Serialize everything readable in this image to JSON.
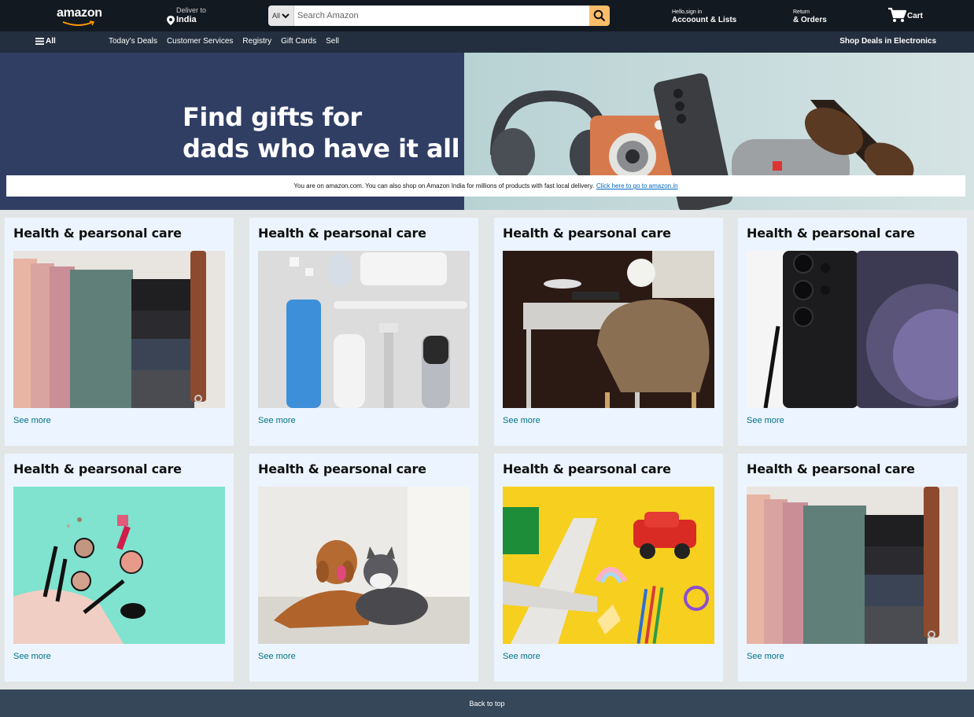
{
  "header": {
    "logo": "amazon",
    "deliver_label": "Deliver to",
    "deliver_location": "India",
    "search_category": "All",
    "search_placeholder": "Search Amazon",
    "account_greeting": "Hello,sign in",
    "account_label": "Accoount & Lists",
    "returns_label": "Return",
    "orders_label": "& Orders",
    "cart_label": "Cart"
  },
  "nav": {
    "all_label": "All",
    "links": [
      "Today's Deals",
      "Customer Services",
      "Registry",
      "Gift Cards",
      "Sell"
    ],
    "right_label": "Shop Deals in Electronics"
  },
  "hero": {
    "headline_line1": "Find gifts for",
    "headline_line2": "dads who have it all"
  },
  "notice": {
    "text": "You are on amazon.com. You can also shop on Amazon India for millions of products with fast local delivery.",
    "link": "Click here to go to amazon.in"
  },
  "cards": [
    {
      "title": "Health & pearsonal care",
      "link": "See more",
      "image": "hangers"
    },
    {
      "title": "Health & pearsonal care",
      "link": "See more",
      "image": "toiletries"
    },
    {
      "title": "Health & pearsonal care",
      "link": "See more",
      "image": "desk-chair"
    },
    {
      "title": "Health & pearsonal care",
      "link": "See more",
      "image": "smartphone"
    },
    {
      "title": "Health & pearsonal care",
      "link": "See more",
      "image": "makeup"
    },
    {
      "title": "Health & pearsonal care",
      "link": "See more",
      "image": "dog-and-cat"
    },
    {
      "title": "Health & pearsonal care",
      "link": "See more",
      "image": "toys"
    },
    {
      "title": "Health & pearsonal care",
      "link": "See more",
      "image": "hangers"
    }
  ],
  "footer": {
    "back_to_top": "Back to top"
  },
  "colors": {
    "topbar": "#131921",
    "navbar": "#232f3e",
    "search_button": "#febd69",
    "card_bg": "#ecf5ff",
    "link": "#007185",
    "footer": "#37475a"
  }
}
